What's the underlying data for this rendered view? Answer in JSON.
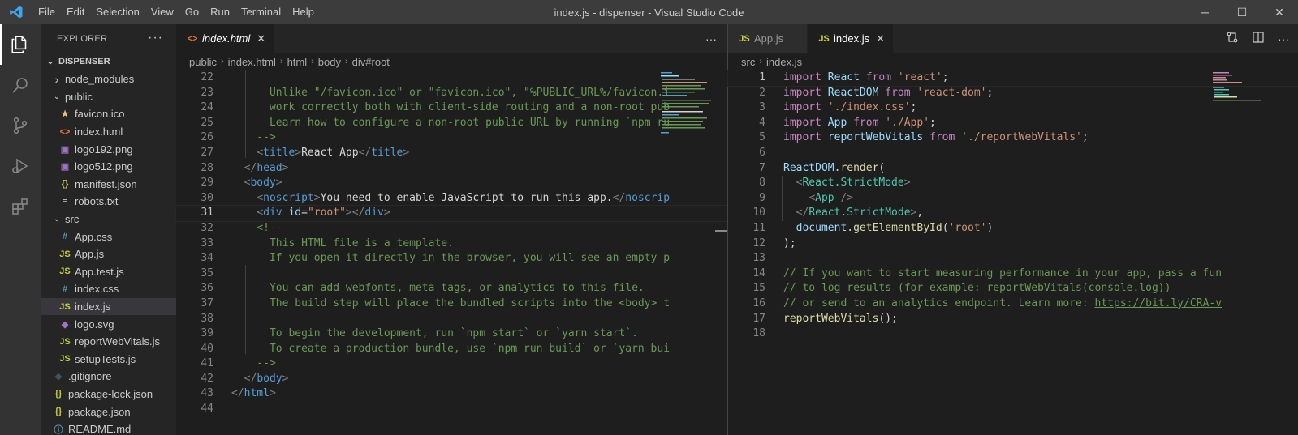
{
  "window": {
    "title": "index.js - dispenser - Visual Studio Code"
  },
  "menu": [
    "File",
    "Edit",
    "Selection",
    "View",
    "Go",
    "Run",
    "Terminal",
    "Help"
  ],
  "sidebar": {
    "header": "EXPLORER",
    "project": "DISPENSER",
    "items": [
      {
        "label": "node_modules",
        "indent": 1,
        "kind": "folder-closed",
        "icon": "",
        "color": "#cccccc"
      },
      {
        "label": "public",
        "indent": 1,
        "kind": "folder-open",
        "icon": "",
        "color": "#cccccc"
      },
      {
        "label": "favicon.ico",
        "indent": 2,
        "kind": "file",
        "icon": "★",
        "color": "#e5c07b"
      },
      {
        "label": "index.html",
        "indent": 2,
        "kind": "file",
        "icon": "<>",
        "color": "#e37933"
      },
      {
        "label": "logo192.png",
        "indent": 2,
        "kind": "file",
        "icon": "▣",
        "color": "#a074c4"
      },
      {
        "label": "logo512.png",
        "indent": 2,
        "kind": "file",
        "icon": "▣",
        "color": "#a074c4"
      },
      {
        "label": "manifest.json",
        "indent": 2,
        "kind": "file",
        "icon": "{}",
        "color": "#cbcb41"
      },
      {
        "label": "robots.txt",
        "indent": 2,
        "kind": "file",
        "icon": "≡",
        "color": "#cccccc"
      },
      {
        "label": "src",
        "indent": 1,
        "kind": "folder-open",
        "icon": "",
        "color": "#cccccc"
      },
      {
        "label": "App.css",
        "indent": 2,
        "kind": "file",
        "icon": "#",
        "color": "#519aba"
      },
      {
        "label": "App.js",
        "indent": 2,
        "kind": "file",
        "icon": "JS",
        "color": "#cbcb41"
      },
      {
        "label": "App.test.js",
        "indent": 2,
        "kind": "file",
        "icon": "JS",
        "color": "#cbcb41"
      },
      {
        "label": "index.css",
        "indent": 2,
        "kind": "file",
        "icon": "#",
        "color": "#519aba"
      },
      {
        "label": "index.js",
        "indent": 2,
        "kind": "file",
        "icon": "JS",
        "color": "#cbcb41",
        "selected": true
      },
      {
        "label": "logo.svg",
        "indent": 2,
        "kind": "file",
        "icon": "◆",
        "color": "#a074c4"
      },
      {
        "label": "reportWebVitals.js",
        "indent": 2,
        "kind": "file",
        "icon": "JS",
        "color": "#cbcb41"
      },
      {
        "label": "setupTests.js",
        "indent": 2,
        "kind": "file",
        "icon": "JS",
        "color": "#cbcb41"
      },
      {
        "label": ".gitignore",
        "indent": 1,
        "kind": "file",
        "icon": "◆",
        "color": "#41535b"
      },
      {
        "label": "package-lock.json",
        "indent": 1,
        "kind": "file",
        "icon": "{}",
        "color": "#cbcb41"
      },
      {
        "label": "package.json",
        "indent": 1,
        "kind": "file",
        "icon": "{}",
        "color": "#cbcb41"
      },
      {
        "label": "README.md",
        "indent": 1,
        "kind": "file",
        "icon": "ⓘ",
        "color": "#519aba"
      }
    ]
  },
  "editor_left": {
    "tab": {
      "label": "index.html",
      "icon": "<>"
    },
    "breadcrumb": [
      "public",
      "index.html",
      "html",
      "body",
      "div#root"
    ],
    "current_line": 31,
    "lines": [
      {
        "n": "22",
        "segs": []
      },
      {
        "n": "23",
        "segs": [
          {
            "t": "      Unlike \"/favicon.ico\" or \"favicon.ico\", \"%PUBLIC_URL%/favicon.i",
            "c": "cmt"
          }
        ]
      },
      {
        "n": "24",
        "segs": [
          {
            "t": "      work correctly both with client-side routing and a non-root pub",
            "c": "cmt"
          }
        ]
      },
      {
        "n": "25",
        "segs": [
          {
            "t": "      Learn how to configure a non-root public URL by running `npm ru",
            "c": "cmt"
          }
        ]
      },
      {
        "n": "26",
        "segs": [
          {
            "t": "    -->",
            "c": "cmt"
          }
        ]
      },
      {
        "n": "27",
        "segs": [
          {
            "t": "    ",
            "c": "txt"
          },
          {
            "t": "<",
            "c": "br"
          },
          {
            "t": "title",
            "c": "tag"
          },
          {
            "t": ">",
            "c": "br"
          },
          {
            "t": "React App",
            "c": "txt"
          },
          {
            "t": "</",
            "c": "br"
          },
          {
            "t": "title",
            "c": "tag"
          },
          {
            "t": ">",
            "c": "br"
          }
        ]
      },
      {
        "n": "28",
        "segs": [
          {
            "t": "  ",
            "c": "txt"
          },
          {
            "t": "</",
            "c": "br"
          },
          {
            "t": "head",
            "c": "tag"
          },
          {
            "t": ">",
            "c": "br"
          }
        ]
      },
      {
        "n": "29",
        "segs": [
          {
            "t": "  ",
            "c": "txt"
          },
          {
            "t": "<",
            "c": "br"
          },
          {
            "t": "body",
            "c": "tag"
          },
          {
            "t": ">",
            "c": "br"
          }
        ]
      },
      {
        "n": "30",
        "segs": [
          {
            "t": "    ",
            "c": "txt"
          },
          {
            "t": "<",
            "c": "br"
          },
          {
            "t": "noscript",
            "c": "tag"
          },
          {
            "t": ">",
            "c": "br"
          },
          {
            "t": "You need to enable JavaScript to run this app.",
            "c": "txt"
          },
          {
            "t": "</",
            "c": "br"
          },
          {
            "t": "noscrip",
            "c": "tag"
          }
        ]
      },
      {
        "n": "31",
        "segs": [
          {
            "t": "    ",
            "c": "txt"
          },
          {
            "t": "<",
            "c": "br"
          },
          {
            "t": "div",
            "c": "tag"
          },
          {
            "t": " ",
            "c": "txt"
          },
          {
            "t": "id",
            "c": "attr"
          },
          {
            "t": "=",
            "c": "txt"
          },
          {
            "t": "\"root\"",
            "c": "str"
          },
          {
            "t": "></",
            "c": "br"
          },
          {
            "t": "div",
            "c": "tag"
          },
          {
            "t": ">",
            "c": "br"
          }
        ]
      },
      {
        "n": "32",
        "segs": [
          {
            "t": "    <!--",
            "c": "cmt"
          }
        ]
      },
      {
        "n": "33",
        "segs": [
          {
            "t": "      This HTML file is a template.",
            "c": "cmt"
          }
        ]
      },
      {
        "n": "34",
        "segs": [
          {
            "t": "      If you open it directly in the browser, you will see an empty p",
            "c": "cmt"
          }
        ]
      },
      {
        "n": "35",
        "segs": []
      },
      {
        "n": "36",
        "segs": [
          {
            "t": "      You can add webfonts, meta tags, or analytics to this file.",
            "c": "cmt"
          }
        ]
      },
      {
        "n": "37",
        "segs": [
          {
            "t": "      The build step will place the bundled scripts into the <body> t",
            "c": "cmt"
          }
        ]
      },
      {
        "n": "38",
        "segs": []
      },
      {
        "n": "39",
        "segs": [
          {
            "t": "      To begin the development, run `npm start` or `yarn start`.",
            "c": "cmt"
          }
        ]
      },
      {
        "n": "40",
        "segs": [
          {
            "t": "      To create a production bundle, use `npm run build` or `yarn bui",
            "c": "cmt"
          }
        ]
      },
      {
        "n": "41",
        "segs": [
          {
            "t": "    -->",
            "c": "cmt"
          }
        ]
      },
      {
        "n": "42",
        "segs": [
          {
            "t": "  ",
            "c": "txt"
          },
          {
            "t": "</",
            "c": "br"
          },
          {
            "t": "body",
            "c": "tag"
          },
          {
            "t": ">",
            "c": "br"
          }
        ]
      },
      {
        "n": "43",
        "segs": [
          {
            "t": "</",
            "c": "br"
          },
          {
            "t": "html",
            "c": "tag"
          },
          {
            "t": ">",
            "c": "br"
          }
        ]
      },
      {
        "n": "44",
        "segs": []
      }
    ]
  },
  "editor_right": {
    "tabs": [
      {
        "label": "App.js",
        "icon": "JS",
        "active": false
      },
      {
        "label": "index.js",
        "icon": "JS",
        "active": true
      }
    ],
    "breadcrumb": [
      "src",
      "index.js"
    ],
    "current_line": 1,
    "lines": [
      {
        "n": "1",
        "segs": [
          {
            "t": "import",
            "c": "kw"
          },
          {
            "t": " ",
            "c": "txt"
          },
          {
            "t": "React",
            "c": "var"
          },
          {
            "t": " ",
            "c": "txt"
          },
          {
            "t": "from",
            "c": "kw"
          },
          {
            "t": " ",
            "c": "txt"
          },
          {
            "t": "'react'",
            "c": "str"
          },
          {
            "t": ";",
            "c": "txt"
          }
        ]
      },
      {
        "n": "2",
        "segs": [
          {
            "t": "import",
            "c": "kw"
          },
          {
            "t": " ",
            "c": "txt"
          },
          {
            "t": "ReactDOM",
            "c": "var"
          },
          {
            "t": " ",
            "c": "txt"
          },
          {
            "t": "from",
            "c": "kw"
          },
          {
            "t": " ",
            "c": "txt"
          },
          {
            "t": "'react-dom'",
            "c": "str"
          },
          {
            "t": ";",
            "c": "txt"
          }
        ]
      },
      {
        "n": "3",
        "segs": [
          {
            "t": "import",
            "c": "kw"
          },
          {
            "t": " ",
            "c": "txt"
          },
          {
            "t": "'./index.css'",
            "c": "str"
          },
          {
            "t": ";",
            "c": "txt"
          }
        ]
      },
      {
        "n": "4",
        "segs": [
          {
            "t": "import",
            "c": "kw"
          },
          {
            "t": " ",
            "c": "txt"
          },
          {
            "t": "App",
            "c": "var"
          },
          {
            "t": " ",
            "c": "txt"
          },
          {
            "t": "from",
            "c": "kw"
          },
          {
            "t": " ",
            "c": "txt"
          },
          {
            "t": "'./App'",
            "c": "str"
          },
          {
            "t": ";",
            "c": "txt"
          }
        ]
      },
      {
        "n": "5",
        "segs": [
          {
            "t": "import",
            "c": "kw"
          },
          {
            "t": " ",
            "c": "txt"
          },
          {
            "t": "reportWebVitals",
            "c": "var"
          },
          {
            "t": " ",
            "c": "txt"
          },
          {
            "t": "from",
            "c": "kw"
          },
          {
            "t": " ",
            "c": "txt"
          },
          {
            "t": "'./reportWebVitals'",
            "c": "str"
          },
          {
            "t": ";",
            "c": "txt"
          }
        ]
      },
      {
        "n": "6",
        "segs": []
      },
      {
        "n": "7",
        "segs": [
          {
            "t": "ReactDOM",
            "c": "var"
          },
          {
            "t": ".",
            "c": "txt"
          },
          {
            "t": "render",
            "c": "fn"
          },
          {
            "t": "(",
            "c": "txt"
          }
        ]
      },
      {
        "n": "8",
        "segs": [
          {
            "t": "  ",
            "c": "txt"
          },
          {
            "t": "<",
            "c": "br"
          },
          {
            "t": "React.StrictMode",
            "c": "cls"
          },
          {
            "t": ">",
            "c": "br"
          }
        ]
      },
      {
        "n": "9",
        "segs": [
          {
            "t": "    ",
            "c": "txt"
          },
          {
            "t": "<",
            "c": "br"
          },
          {
            "t": "App",
            "c": "cls"
          },
          {
            "t": " />",
            "c": "br"
          }
        ]
      },
      {
        "n": "10",
        "segs": [
          {
            "t": "  ",
            "c": "txt"
          },
          {
            "t": "</",
            "c": "br"
          },
          {
            "t": "React.StrictMode",
            "c": "cls"
          },
          {
            "t": ">",
            "c": "br"
          },
          {
            "t": ",",
            "c": "txt"
          }
        ]
      },
      {
        "n": "11",
        "segs": [
          {
            "t": "  ",
            "c": "txt"
          },
          {
            "t": "document",
            "c": "var"
          },
          {
            "t": ".",
            "c": "txt"
          },
          {
            "t": "getElementById",
            "c": "fn"
          },
          {
            "t": "(",
            "c": "txt"
          },
          {
            "t": "'root'",
            "c": "str"
          },
          {
            "t": ")",
            "c": "txt"
          }
        ]
      },
      {
        "n": "12",
        "segs": [
          {
            "t": ");",
            "c": "txt"
          }
        ]
      },
      {
        "n": "13",
        "segs": []
      },
      {
        "n": "14",
        "segs": [
          {
            "t": "// If you want to start measuring performance in your app, pass a fun",
            "c": "cmt"
          }
        ]
      },
      {
        "n": "15",
        "segs": [
          {
            "t": "// to log results (for example: reportWebVitals(console.log))",
            "c": "cmt"
          }
        ]
      },
      {
        "n": "16",
        "segs": [
          {
            "t": "// or send to an analytics endpoint. Learn more: ",
            "c": "cmt"
          },
          {
            "t": "https://bit.ly/CRA-v",
            "c": "link"
          }
        ]
      },
      {
        "n": "17",
        "segs": [
          {
            "t": "reportWebVitals",
            "c": "fn"
          },
          {
            "t": "();",
            "c": "txt"
          }
        ]
      },
      {
        "n": "18",
        "segs": []
      }
    ]
  }
}
